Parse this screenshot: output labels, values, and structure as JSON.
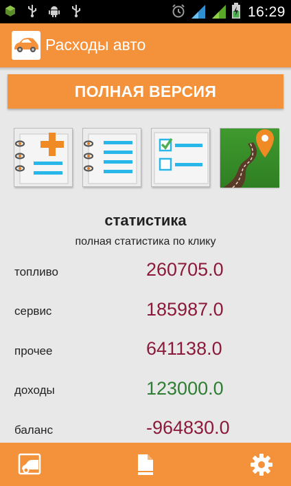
{
  "status_bar": {
    "time": "16:29"
  },
  "app_bar": {
    "title": "Расходы авто"
  },
  "full_version_button": {
    "label": "ПОЛНАЯ ВЕРСИЯ"
  },
  "stats": {
    "title": "статистика",
    "subtitle": "полная статистика по клику",
    "rows": [
      {
        "label": "топливо",
        "value": "260705.0",
        "color": "#8b1a3a"
      },
      {
        "label": "сервис",
        "value": "185987.0",
        "color": "#8b1a3a"
      },
      {
        "label": "прочее",
        "value": "641138.0",
        "color": "#8b1a3a"
      },
      {
        "label": "доходы",
        "value": "123000.0",
        "color": "#2e7d32"
      },
      {
        "label": "баланс",
        "value": "-964830.0",
        "color": "#8b1a3a"
      }
    ]
  },
  "colors": {
    "accent": "#f4913b",
    "expense": "#8b1a3a",
    "income": "#2e7d32"
  }
}
